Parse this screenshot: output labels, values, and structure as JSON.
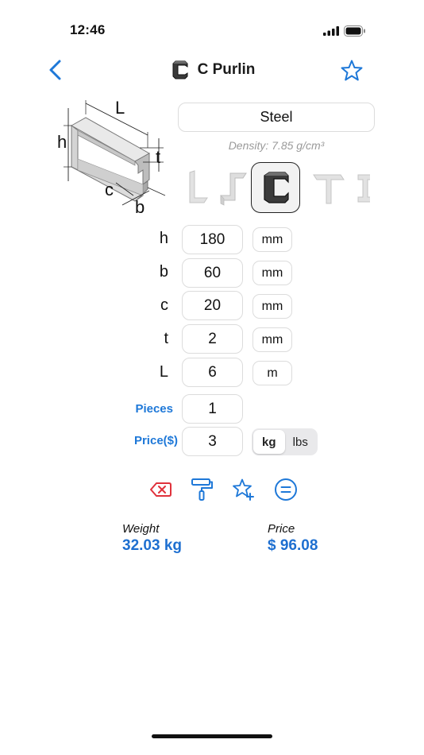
{
  "status": {
    "time": "12:46"
  },
  "nav": {
    "back_icon": "chevron-left-icon",
    "title": "C Purlin",
    "title_icon": "c-purlin-icon",
    "favorite_icon": "star-outline-icon"
  },
  "diagram": {
    "labels": {
      "L": "L",
      "h": "h",
      "t": "t",
      "c": "c",
      "b": "b"
    }
  },
  "material": {
    "value": "Steel",
    "density": "Density: 7.85 g/cm³"
  },
  "profiles": [
    {
      "icon": "angle-profile-icon",
      "selected": false
    },
    {
      "icon": "z-purlin-profile-icon",
      "selected": false
    },
    {
      "icon": "c-purlin-profile-icon",
      "selected": true
    },
    {
      "icon": "t-bar-profile-icon",
      "selected": false
    },
    {
      "icon": "i-beam-profile-icon",
      "selected": false
    }
  ],
  "inputs": [
    {
      "label": "h",
      "value": "180",
      "unit": "mm"
    },
    {
      "label": "b",
      "value": "60",
      "unit": "mm"
    },
    {
      "label": "c",
      "value": "20",
      "unit": "mm"
    },
    {
      "label": "t",
      "value": "2",
      "unit": "mm"
    },
    {
      "label": "L",
      "value": "6",
      "unit": "m"
    }
  ],
  "pieces": {
    "label": "Pieces",
    "value": "1"
  },
  "price": {
    "label": "Price($)",
    "value": "3"
  },
  "weight_unit": {
    "options": [
      "kg",
      "lbs"
    ],
    "selected": "kg"
  },
  "actions": [
    "clear-icon",
    "paint-roller-icon",
    "star-add-icon",
    "equals-icon"
  ],
  "results": {
    "weight": {
      "label": "Weight",
      "value": "32.03  kg"
    },
    "price": {
      "label": "Price",
      "value": "$ 96.08"
    }
  },
  "colors": {
    "accent": "#1e78d8",
    "danger": "#e0323c",
    "result": "#1e6fd0"
  }
}
